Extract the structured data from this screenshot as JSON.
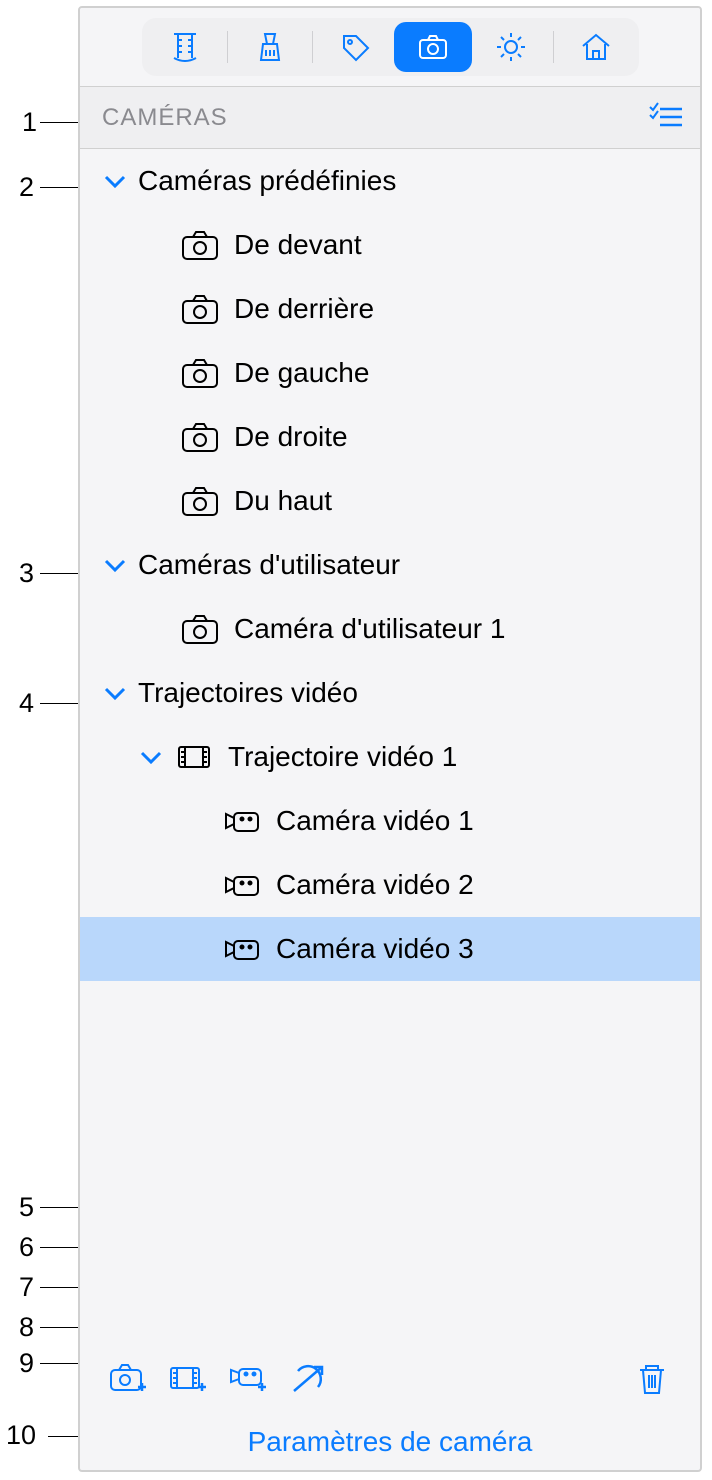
{
  "callouts": [
    "1",
    "2",
    "3",
    "4",
    "5",
    "6",
    "7",
    "8",
    "9",
    "10"
  ],
  "section": {
    "title": "CAMÉRAS"
  },
  "groups": {
    "predefined": {
      "label": "Caméras prédéfinies",
      "items": [
        "De devant",
        "De derrière",
        "De gauche",
        "De droite",
        "Du haut"
      ]
    },
    "user": {
      "label": "Caméras d'utilisateur",
      "items": [
        "Caméra d'utilisateur 1"
      ]
    },
    "video": {
      "label": "Trajectoires vidéo",
      "paths": [
        {
          "label": "Trajectoire vidéo 1",
          "cameras": [
            "Caméra vidéo 1",
            "Caméra vidéo 2",
            "Caméra vidéo 3"
          ],
          "selected_index": 2
        }
      ]
    }
  },
  "footer": {
    "link": "Paramètres de caméra"
  },
  "colors": {
    "accent": "#0a7cff",
    "selected": "#b9d7fb"
  }
}
